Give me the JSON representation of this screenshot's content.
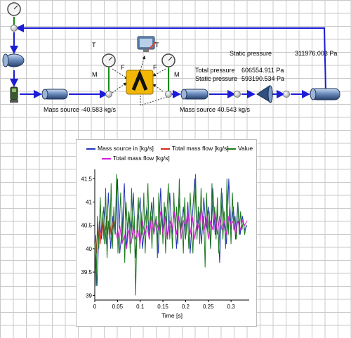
{
  "diagram": {
    "labels": {
      "t_left": "T",
      "m_left": "M",
      "f_left": "F",
      "t_right": "T",
      "m_right": "M",
      "f_right": "F",
      "static_pressure_title": "Static pressure",
      "static_pressure_value": "311976.003 Pa",
      "total_pressure_label": "Total pressure",
      "total_pressure_value": "606554.911 Pa",
      "static_pressure_label": "Static pressure",
      "static_pressure_value_2": "593190.534 Pa",
      "mass_source_1": "Mass source  -40.583 kg/s",
      "mass_source_2": "Mass source  40.543 kg/s"
    },
    "colors": {
      "line": "#1c1cd6",
      "stem": "#1a8a1a",
      "node": "#d8d8d8",
      "pipe": "#3b5d8f"
    }
  },
  "chart_data": {
    "type": "line",
    "xlabel": "Time [s]",
    "ylabel": "",
    "xlim": [
      0,
      0.34
    ],
    "ylim": [
      38.9,
      41.7
    ],
    "xticks": [
      "0",
      "0.05",
      "0.1",
      "0.15",
      "0.2",
      "0.25",
      "0.3"
    ],
    "yticks": [
      "39",
      "39.5",
      "40",
      "40.5",
      "41",
      "41.5"
    ],
    "legend_position": "top",
    "series": [
      {
        "name": "Mass source in [kg/s]",
        "color": "#2233bb",
        "x": [
          0,
          0.005,
          0.01,
          0.015,
          0.02,
          0.025,
          0.03,
          0.035,
          0.04,
          0.045,
          0.05,
          0.055,
          0.06,
          0.065,
          0.07,
          0.075,
          0.08,
          0.085,
          0.09,
          0.095,
          0.1,
          0.105,
          0.11,
          0.115,
          0.12,
          0.125,
          0.13,
          0.135,
          0.14,
          0.145,
          0.15,
          0.155,
          0.16,
          0.165,
          0.17,
          0.175,
          0.18,
          0.185,
          0.19,
          0.195,
          0.2,
          0.205,
          0.21,
          0.215,
          0.22,
          0.225,
          0.23,
          0.235,
          0.24,
          0.245,
          0.25,
          0.255,
          0.26,
          0.265,
          0.27,
          0.275,
          0.28,
          0.285,
          0.29,
          0.295,
          0.3,
          0.305,
          0.31,
          0.315,
          0.32,
          0.325,
          0.33,
          0.335
        ],
        "y": [
          40.3,
          39.2,
          40.6,
          40.2,
          40.9,
          40.1,
          41.2,
          40.0,
          40.7,
          40.3,
          41.5,
          39.9,
          40.4,
          41.4,
          40.0,
          40.8,
          40.3,
          41.2,
          39.8,
          40.6,
          41.1,
          40.0,
          40.5,
          40.9,
          40.2,
          41.0,
          40.3,
          40.7,
          39.9,
          41.3,
          40.4,
          40.9,
          40.2,
          41.2,
          40.3,
          40.8,
          40.0,
          41.1,
          40.4,
          40.9,
          40.2,
          41.0,
          39.9,
          40.7,
          41.5,
          40.3,
          40.8,
          40.1,
          41.1,
          40.4,
          40.9,
          40.0,
          41.3,
          40.3,
          40.8,
          39.7,
          41.2,
          40.5,
          40.1,
          41.5,
          40.4,
          40.9,
          40.2,
          41.0,
          40.3,
          40.7,
          40.4,
          40.5
        ]
      },
      {
        "name": "Total mass flow [kg/s]",
        "color": "#d42a1c",
        "x": [
          0,
          0.002,
          0.004,
          0.006,
          0.008,
          0.01,
          0.012,
          0.014,
          0.016,
          0.018,
          0.02,
          0.022,
          0.024,
          0.026,
          0.028,
          0.03,
          0.032,
          0.034,
          0.036,
          0.038,
          0.04,
          0.042,
          0.044
        ],
        "y": [
          40.0,
          40.3,
          39.9,
          40.4,
          40.2,
          40.5,
          40.1,
          40.4,
          40.3,
          40.6,
          40.2,
          40.5,
          40.4,
          40.7,
          40.3,
          40.6,
          40.4,
          40.5,
          40.3,
          40.6,
          40.4,
          40.6,
          40.5
        ]
      },
      {
        "name": "Value",
        "color": "#1d7a1d",
        "x": [
          0,
          0.003,
          0.006,
          0.009,
          0.012,
          0.015,
          0.018,
          0.021,
          0.024,
          0.027,
          0.03,
          0.033,
          0.036,
          0.039,
          0.042,
          0.045,
          0.048,
          0.051,
          0.054,
          0.057,
          0.06,
          0.063,
          0.066,
          0.069,
          0.072,
          0.075,
          0.078,
          0.081,
          0.084,
          0.087,
          0.09,
          0.093,
          0.096,
          0.099,
          0.102,
          0.105,
          0.108,
          0.111,
          0.114,
          0.117,
          0.12,
          0.123,
          0.126,
          0.129,
          0.132,
          0.135,
          0.138,
          0.141,
          0.144,
          0.147,
          0.15,
          0.153,
          0.156,
          0.159,
          0.162,
          0.165,
          0.168,
          0.171,
          0.174,
          0.177,
          0.18,
          0.183,
          0.186,
          0.189,
          0.192,
          0.195,
          0.198,
          0.201,
          0.204,
          0.207,
          0.21,
          0.213,
          0.216,
          0.219,
          0.222,
          0.225,
          0.228,
          0.231,
          0.234,
          0.237,
          0.24,
          0.243,
          0.246,
          0.249,
          0.252,
          0.255,
          0.258,
          0.261,
          0.264,
          0.267,
          0.27,
          0.273,
          0.276,
          0.279,
          0.282,
          0.285,
          0.288,
          0.291,
          0.294,
          0.297,
          0.3,
          0.303,
          0.306,
          0.309,
          0.312,
          0.315,
          0.318,
          0.321,
          0.324,
          0.327,
          0.33,
          0.333
        ],
        "y": [
          40.1,
          39.2,
          40.7,
          40.0,
          41.1,
          40.3,
          40.8,
          40.1,
          41.3,
          39.8,
          40.6,
          40.2,
          41.4,
          40.0,
          40.9,
          40.3,
          41.6,
          39.9,
          40.5,
          41.2,
          40.1,
          40.9,
          39.7,
          41.0,
          40.4,
          40.8,
          39.9,
          41.3,
          40.2,
          40.7,
          39.0,
          40.6,
          41.1,
          40.0,
          40.8,
          40.3,
          41.2,
          39.9,
          40.7,
          41.4,
          40.2,
          40.8,
          40.0,
          41.1,
          40.4,
          40.7,
          39.8,
          41.2,
          40.3,
          40.9,
          40.1,
          41.0,
          39.9,
          40.8,
          41.4,
          40.2,
          40.7,
          40.0,
          41.2,
          40.4,
          40.9,
          40.1,
          41.5,
          40.3,
          40.7,
          39.9,
          41.1,
          40.3,
          40.8,
          40.0,
          41.2,
          40.5,
          39.9,
          40.8,
          41.6,
          40.2,
          40.9,
          40.1,
          41.3,
          40.4,
          40.7,
          39.6,
          41.2,
          40.3,
          40.8,
          40.0,
          41.4,
          40.4,
          40.9,
          40.2,
          41.1,
          39.9,
          40.7,
          41.3,
          40.2,
          40.8,
          40.0,
          41.5,
          40.3,
          40.9,
          40.1,
          41.2,
          40.4,
          40.7,
          40.2,
          41.0,
          40.3,
          40.8,
          40.4,
          40.6,
          40.3,
          40.5
        ]
      },
      {
        "name": "Total mass flow [kg/s]",
        "color": "#d81cd8",
        "x": [
          0.045,
          0.05,
          0.055,
          0.06,
          0.065,
          0.07,
          0.075,
          0.08,
          0.085,
          0.09,
          0.095,
          0.1,
          0.105,
          0.11,
          0.115,
          0.12,
          0.125,
          0.13,
          0.135,
          0.14,
          0.145,
          0.15,
          0.155,
          0.16,
          0.165,
          0.17,
          0.175,
          0.18,
          0.185,
          0.19,
          0.195,
          0.2,
          0.205,
          0.21,
          0.215,
          0.22,
          0.225,
          0.23,
          0.235,
          0.24,
          0.245,
          0.25,
          0.255,
          0.26,
          0.265,
          0.27,
          0.275,
          0.28,
          0.285,
          0.29,
          0.295,
          0.3,
          0.305,
          0.31,
          0.315,
          0.32,
          0.325,
          0.33,
          0.335
        ],
        "y": [
          40.4,
          40.2,
          40.5,
          40.1,
          40.3,
          40.0,
          40.4,
          40.1,
          40.5,
          40.2,
          40.4,
          40.1,
          40.6,
          40.3,
          40.5,
          40.2,
          40.7,
          40.3,
          40.6,
          40.4,
          40.8,
          40.3,
          40.7,
          40.2,
          40.6,
          40.4,
          40.8,
          40.3,
          40.7,
          40.2,
          40.6,
          40.5,
          40.8,
          40.3,
          40.7,
          40.2,
          40.6,
          40.4,
          40.9,
          40.3,
          40.7,
          40.2,
          40.6,
          40.4,
          40.8,
          40.3,
          40.7,
          40.4,
          40.6,
          40.3,
          40.7,
          40.5,
          40.6,
          40.3,
          40.6,
          40.4,
          40.6,
          40.5,
          40.6
        ]
      }
    ]
  }
}
